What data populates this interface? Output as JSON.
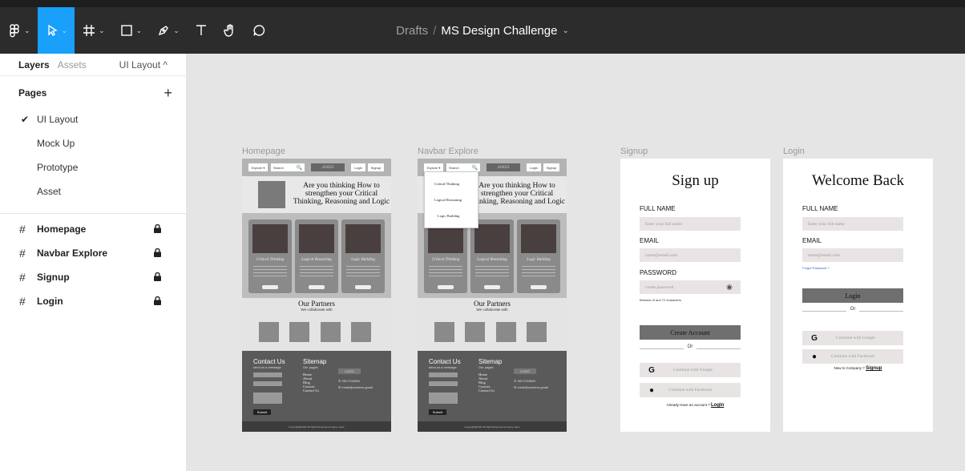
{
  "toolbar": {
    "tools": [
      "main-menu",
      "move",
      "frame",
      "shape",
      "pen",
      "text",
      "hand",
      "comment"
    ]
  },
  "title": {
    "drafts": "Drafts",
    "separator": "/",
    "document": "MS Design Challenge"
  },
  "sidebar": {
    "tab_layers": "Layers",
    "tab_assets": "Assets",
    "current_page": "UI Layout ^",
    "pages_heading": "Pages",
    "add_page": "+",
    "pages": [
      {
        "label": "UI Layout",
        "checked": true
      },
      {
        "label": "Mock Up"
      },
      {
        "label": "Prototype"
      },
      {
        "label": "Asset"
      }
    ],
    "layers": [
      "Homepage",
      "Navbar Explore",
      "Signup",
      "Login"
    ]
  },
  "canvas": {
    "homepage": {
      "label": "Homepage",
      "nav": {
        "explore": "Explore ▾",
        "search": "Search",
        "logo": "LOGO",
        "login": "Login",
        "signup": "Signup"
      },
      "hero": "Are you thinking How to strengthen your Critical Thinking, Reasoning and Logic",
      "cards": [
        {
          "title": "Critical Thinking",
          "button": "Learn More"
        },
        {
          "title": "Logical Reasoning",
          "button": "Learn More"
        },
        {
          "title": "Logic Building",
          "button": "Learn More"
        }
      ],
      "partners_title": "Our Partners",
      "partners_sub": "We collaborate with",
      "footer": {
        "contact": "Contact Us",
        "contact_sub": "send us a message",
        "sitemap": "Sitemap",
        "sitemap_sub": "Our pages",
        "links": [
          "Home",
          "About",
          "Blog",
          "Courses",
          "Contact Us"
        ],
        "logo": "LOGO",
        "phone": "9817234568",
        "email": "email@address.gmail",
        "full_name": "Full Name",
        "your_email": "Your Email",
        "your_message": "Your Message",
        "submit": "Submit",
        "copyright": "Copyright@2022 All Right Reserved company name"
      }
    },
    "navbar_explore": {
      "label": "Navbar Explore",
      "hero": "Are you thinking How to strengthen your Critical Thinking, Reasoning and Logic",
      "dropdown": [
        "Critical Thinking",
        "Logical Reasoning",
        "Logic Building"
      ]
    },
    "signup": {
      "label": "Signup",
      "heading": "Sign up",
      "full_name": "FULL NAME",
      "full_name_ph": "Enter your full name",
      "email": "EMAIL",
      "email_ph": "name@email.com",
      "password": "PASSWORD",
      "password_ph": "create password",
      "hint": "Between 8 and 72 characters",
      "create": "Create Account",
      "or": "Or",
      "google": "Continue with Google",
      "facebook": "Continue with Facebook",
      "have_account": "Already Have an account ?",
      "login_link": "Login"
    },
    "login": {
      "label": "Login",
      "heading": "Welcome Back",
      "full_name": "FULL NAME",
      "full_name_ph": "Enter your full name",
      "email": "EMAIL",
      "email_ph": "name@email.com",
      "forgot": "Forgot Password ?",
      "login_btn": "Login",
      "or": "Or",
      "google": "Continue with Google",
      "facebook": "Continue with Facebook",
      "new_to": "New to Company ?",
      "signup_link": "Signup"
    }
  }
}
